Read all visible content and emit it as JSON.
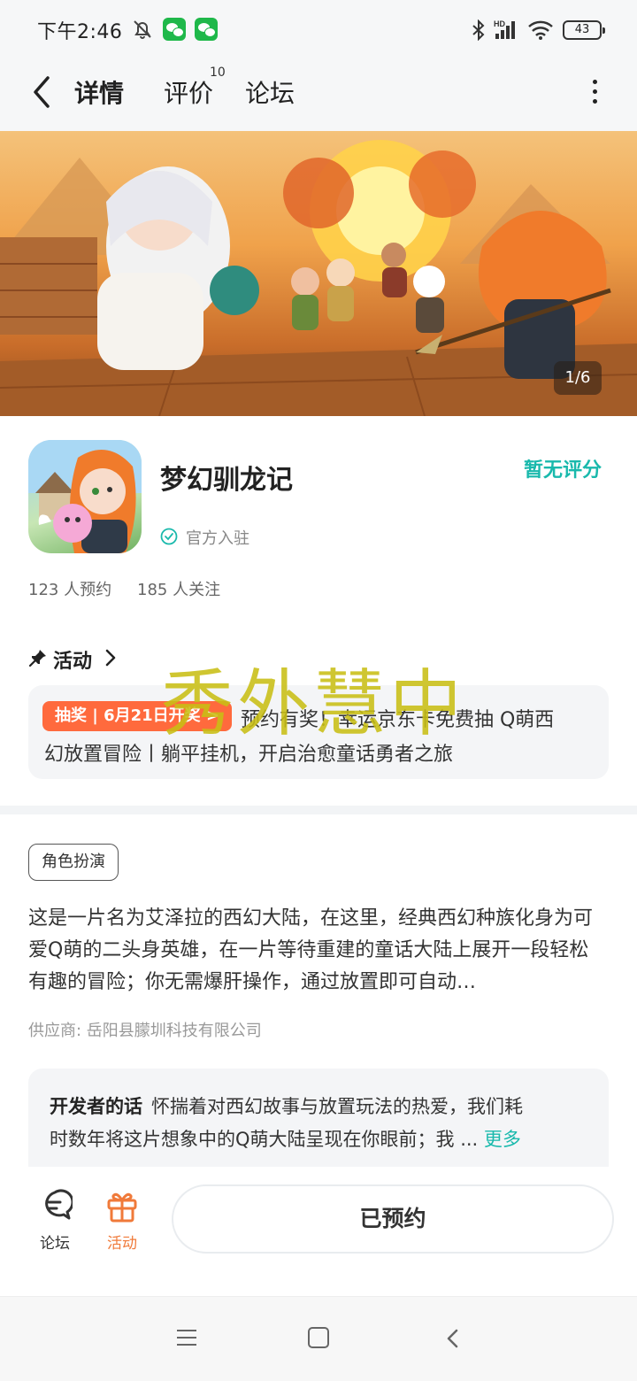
{
  "status_bar": {
    "time": "下午2:46",
    "battery": "43",
    "signal_label": "HD"
  },
  "nav": {
    "tabs": [
      {
        "label": "详情",
        "active": true
      },
      {
        "label": "评价",
        "count": "10"
      },
      {
        "label": "论坛"
      }
    ]
  },
  "banner": {
    "counter": "1/6"
  },
  "app": {
    "name": "梦幻驯龙记",
    "rating_text": "暂无评分",
    "official_label": "官方入驻",
    "reservations": "123 人预约",
    "followers": "185 人关注"
  },
  "activity": {
    "section_title": "活动",
    "badge": "抽奖 | 6月21日开奖 >",
    "line1": "预约有奖！幸运京东卡免费抽 Q萌西",
    "line2": "幻放置冒险丨躺平挂机，开启治愈童话勇者之旅"
  },
  "watermark": "秀外慧中",
  "detail": {
    "tag": "角色扮演",
    "description": "这是一片名为艾泽拉的西幻大陆，在这里，经典西幻种族化身为可爱Q萌的二头身英雄，在一片等待重建的童话大陆上展开一段轻松有趣的冒险；你无需爆肝操作，通过放置即可自动…",
    "supplier": "供应商: 岳阳县朦圳科技有限公司"
  },
  "developer": {
    "title": "开发者的话",
    "line1": "怀揣着对西幻故事与放置玩法的热爱，我们耗",
    "line2": "时数年将这片想象中的Q萌大陆呈现在你眼前；我 ...",
    "more": "更多"
  },
  "bottom_bar": {
    "forum_label": "论坛",
    "activity_label": "活动",
    "reserve_button": "已预约",
    "activity_color": "#f07a3a"
  },
  "colors": {
    "accent": "#19c3b5",
    "badge": "#ff6a3d"
  }
}
